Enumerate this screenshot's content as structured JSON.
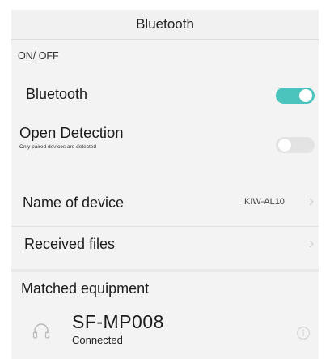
{
  "header": {
    "title": "Bluetooth"
  },
  "section_label": "ON/ OFF",
  "bluetooth_row": {
    "label": "Bluetooth",
    "enabled": true
  },
  "detection_row": {
    "label": "Open Detection",
    "sublabel": "Only paired devices are detected",
    "enabled": false
  },
  "name_row": {
    "label": "Name of device",
    "value": "KIW-AL10"
  },
  "received_row": {
    "label": "Received files"
  },
  "matched": {
    "title": "Matched equipment",
    "devices": [
      {
        "name": "SF-MP008",
        "status": "Connected",
        "icon": "headphones-icon"
      }
    ]
  },
  "colors": {
    "accent": "#4cc4be",
    "toggle_off": "#e3e3e3",
    "background": "#f3f3f3"
  }
}
